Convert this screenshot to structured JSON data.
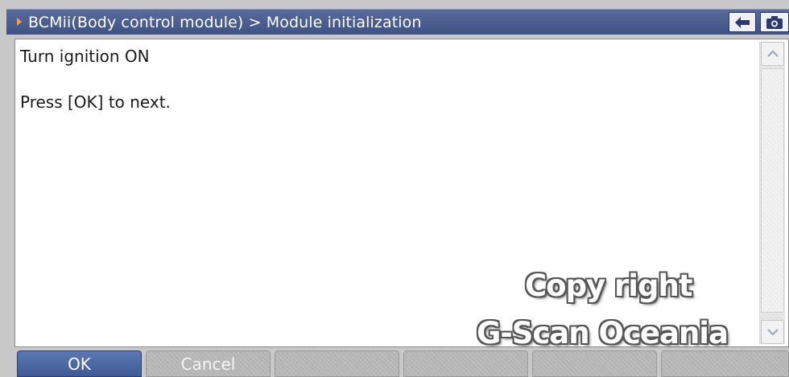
{
  "header": {
    "title": "BCMii(Body control module) > Module initialization",
    "icons": {
      "back": "arrow-left-icon",
      "capture": "camera-icon"
    }
  },
  "content": {
    "lines": [
      "Turn ignition ON",
      "Press [OK] to next."
    ]
  },
  "footer": {
    "buttons": [
      "OK",
      "Cancel",
      "",
      "",
      "",
      ""
    ]
  },
  "watermark": {
    "line1": "Copy right",
    "line2": "G-Scan Oceania"
  },
  "colors": {
    "titlebar": "#4a5d90",
    "accent_arrow": "#f2a132",
    "active_button": "#4d6aa6",
    "inactive_button": "#b3b3b3"
  }
}
